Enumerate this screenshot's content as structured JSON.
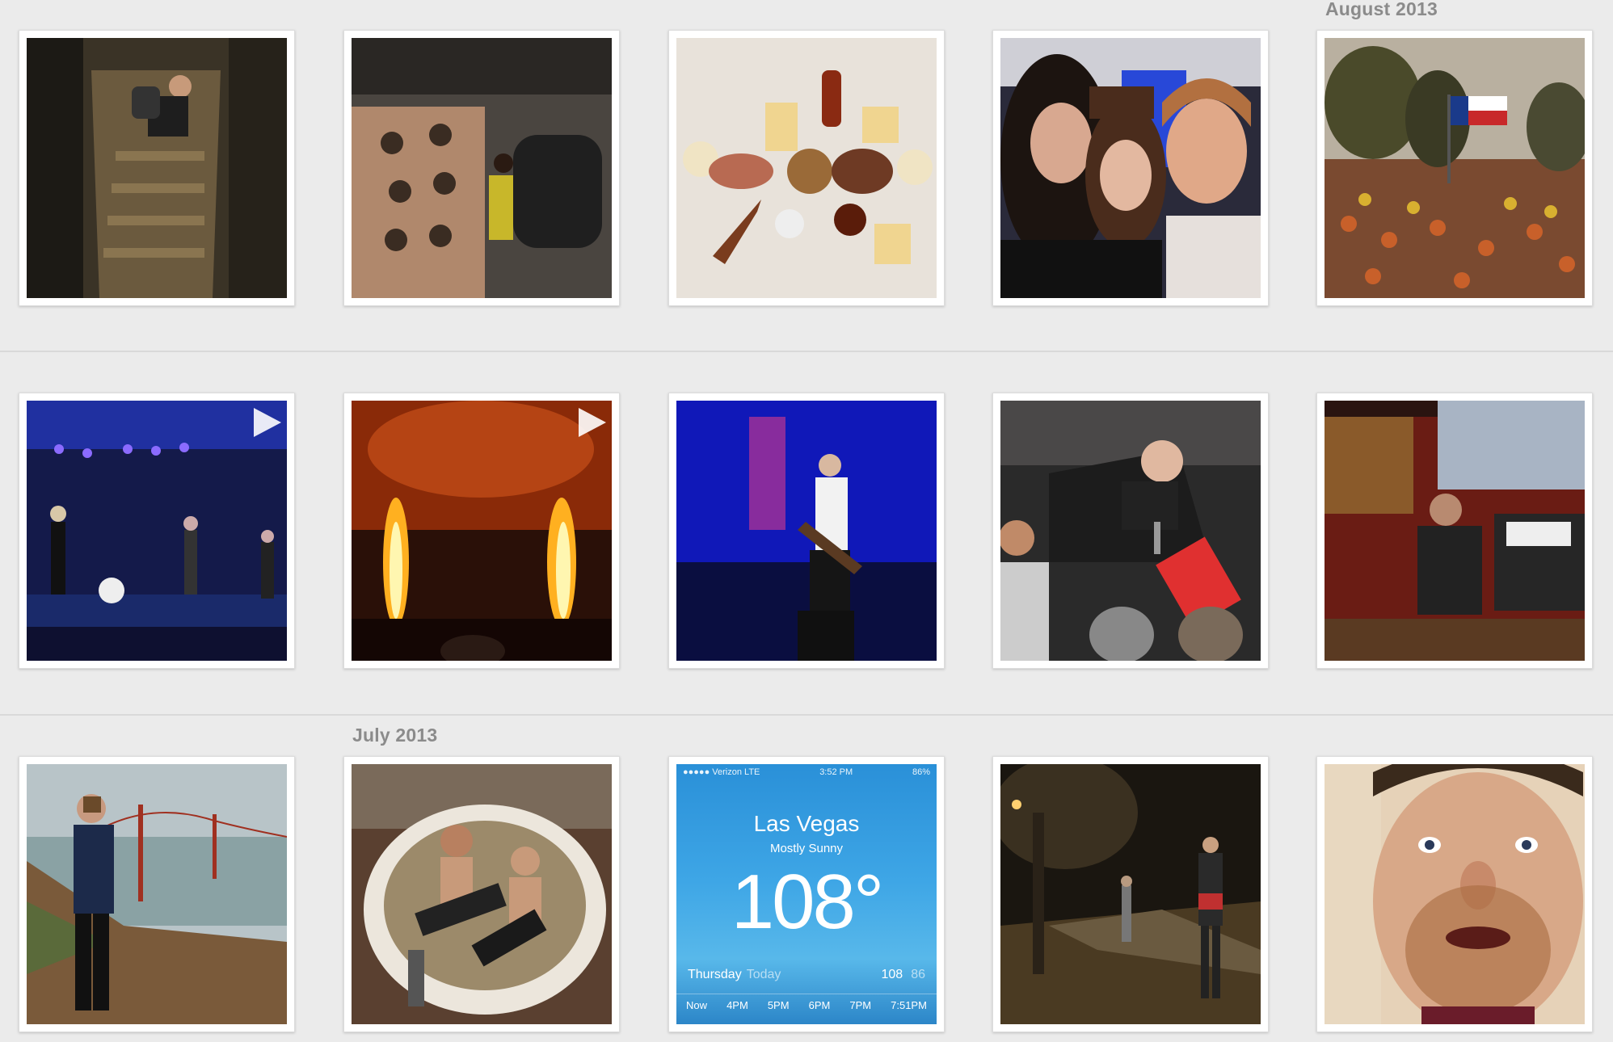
{
  "months": {
    "august": "August 2013",
    "july": "July 2013"
  },
  "photos": [
    {
      "description": "stairwell-photo"
    },
    {
      "description": "coffee-roaster-photo"
    },
    {
      "description": "bbq-table-photo"
    },
    {
      "description": "three-friends-selfie"
    },
    {
      "description": "texas-flag-crowd-photo"
    },
    {
      "description": "concert-stage-video",
      "is_video": true
    },
    {
      "description": "fire-stage-video",
      "is_video": true
    },
    {
      "description": "guitarist-blue-stage-photo"
    },
    {
      "description": "singer-crowd-photo"
    },
    {
      "description": "sound-booth-photo"
    },
    {
      "description": "golden-gate-photo"
    },
    {
      "description": "hot-tub-photo"
    },
    {
      "description": "weather-screenshot"
    },
    {
      "description": "night-street-photo"
    },
    {
      "description": "selfie-face-photo"
    }
  ],
  "weather": {
    "carrier": "●●●●● Verizon  LTE",
    "time": "3:52 PM",
    "battery": "86%",
    "city": "Las Vegas",
    "condition": "Mostly Sunny",
    "temp": "108°",
    "day": "Thursday",
    "day_sub": "Today",
    "high": "108",
    "low": "86",
    "hours": [
      "Now",
      "4PM",
      "5PM",
      "6PM",
      "7PM",
      "7:51PM"
    ]
  },
  "colors": {
    "background": "#ebebeb",
    "divider": "#d9d9d9",
    "label": "#8b8b8b"
  }
}
